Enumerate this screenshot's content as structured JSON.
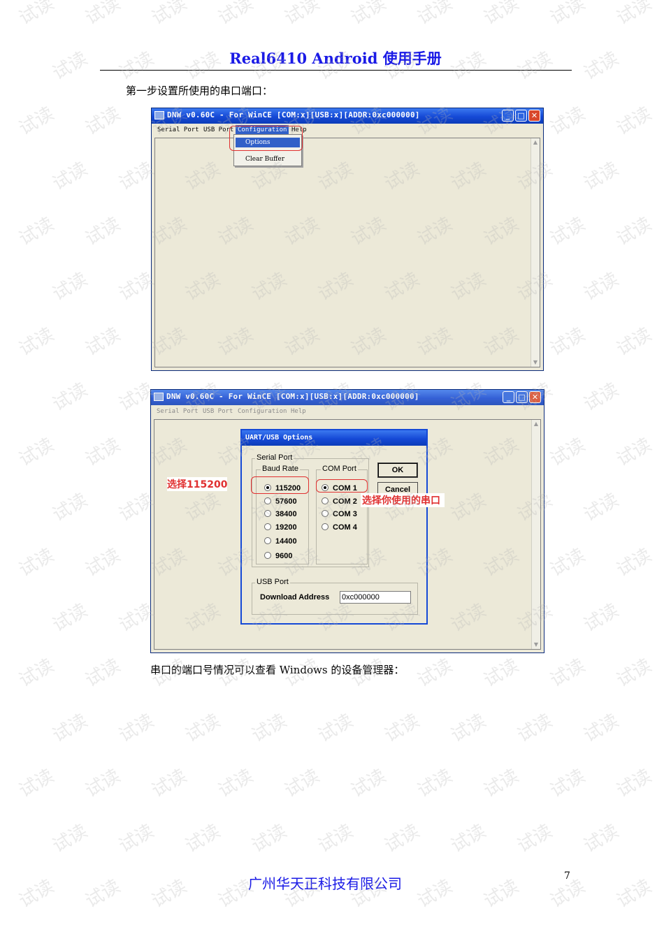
{
  "header": {
    "title": "Real6410 Android 使用手册"
  },
  "body": {
    "step1": "第一步设置所使用的串口端口：",
    "step2": "串口的端口号情况可以查看 Windows 的设备管理器："
  },
  "footer": {
    "company": "广州华天正科技有限公司",
    "page_number": "7"
  },
  "watermark": {
    "text": "试读"
  },
  "window1": {
    "title": "DNW v0.60C - For WinCE    [COM:x][USB:x][ADDR:0xc000000]",
    "menu": [
      "Serial Port",
      "USB Port",
      "Configuration",
      "Help"
    ],
    "dropdown": {
      "options": "Options",
      "clear_buffer": "Clear Buffer"
    }
  },
  "window2": {
    "title": "DNW v0.60C - For WinCE    [COM:x][USB:x][ADDR:0xc000000]",
    "menu": [
      "Serial Port",
      "USB Port",
      "Configuration",
      "Help"
    ]
  },
  "dialog": {
    "title": "UART/USB Options",
    "serial_port_label": "Serial Port",
    "baud_rate_label": "Baud Rate",
    "baud_rates": [
      "115200",
      "57600",
      "38400",
      "19200",
      "14400",
      "9600"
    ],
    "selected_baud": "115200",
    "com_port_label": "COM Port",
    "com_ports": [
      "COM 1",
      "COM 2",
      "COM 3",
      "COM 4"
    ],
    "selected_com": "COM 1",
    "ok": "OK",
    "cancel": "Cancel",
    "usb_port_label": "USB Port",
    "download_address_label": "Download Address",
    "download_address_value": "0xc000000"
  },
  "annotations": {
    "baud_callout": "选择115200",
    "com_callout": "选择你使用的串口"
  },
  "colors": {
    "accent": "#1a1ae6",
    "titlebar": "#1549d6",
    "highlight": "#e03030"
  }
}
